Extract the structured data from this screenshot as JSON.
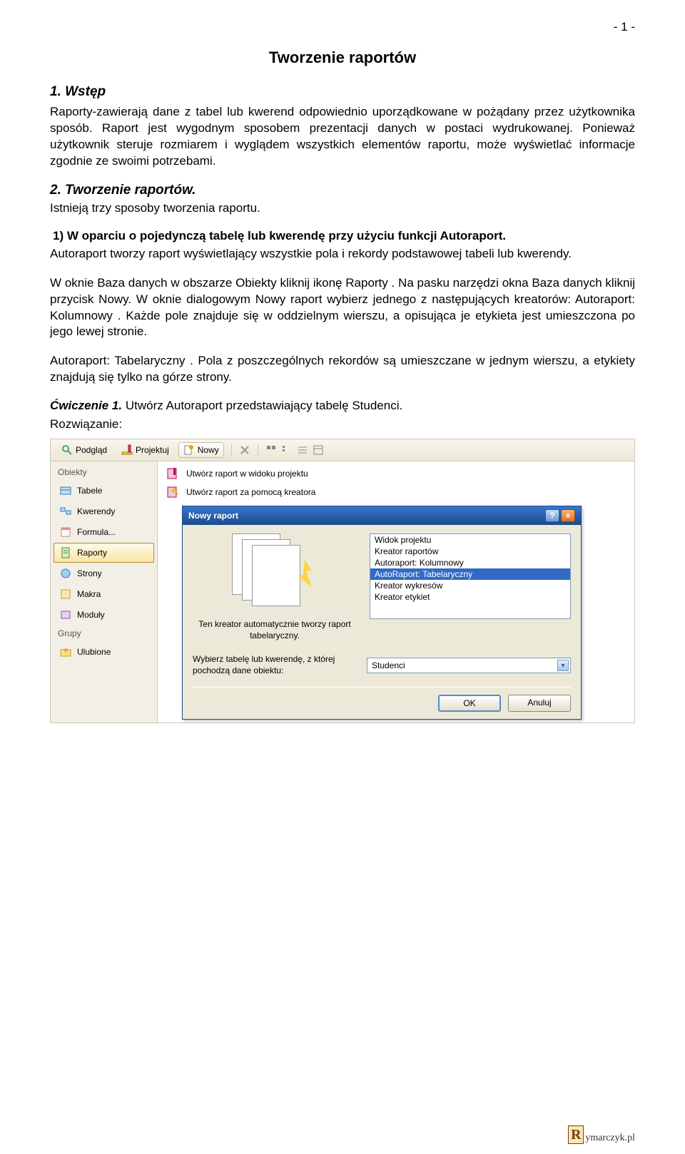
{
  "page_number": "- 1 -",
  "title": "Tworzenie raportów",
  "section1_heading": "1. Wstęp",
  "section1_text": "Raporty-zawierają dane z tabel lub kwerend odpowiednio uporządkowane w pożądany przez użytkownika sposób. Raport jest wygodnym sposobem prezentacji danych w postaci wydrukowanej. Ponieważ użytkownik steruje rozmiarem i wyglądem wszystkich elementów raportu, może wyświetlać informacje zgodnie ze swoimi potrzebami.",
  "section2_heading": "2. Tworzenie raportów.",
  "section2_sub": "Istnieją trzy sposoby tworzenia raportu.",
  "method1_heading": "1) W oparciu o pojedynczą tabelę lub kwerendę przy użyciu funkcji Autoraport.",
  "method1_p1": "Autoraport tworzy raport wyświetlający wszystkie pola i rekordy podstawowej tabeli lub kwerendy.",
  "method1_p2": "W oknie Baza danych w obszarze Obiekty kliknij ikonę Raporty . Na pasku narzędzi okna Baza danych kliknij przycisk Nowy. W oknie dialogowym Nowy raport wybierz jednego z następujących kreatorów: Autoraport: Kolumnowy . Każde pole znajduje się w oddzielnym wierszu, a opisująca je etykieta jest umieszczona po jego lewej stronie.",
  "method1_p3": "Autoraport: Tabelaryczny . Pola z poszczególnych rekordów są umieszczane w jednym wierszu, a etykiety znajdują się tylko na górze strony.",
  "exercise_label": "Ćwiczenie 1.",
  "exercise_text": "Utwórz Autoraport przedstawiający tabelę Studenci.",
  "solution_label": "Rozwiązanie:",
  "app": {
    "toolbar": {
      "preview": "Podgląd",
      "design": "Projektuj",
      "new": "Nowy"
    },
    "sidebar": {
      "objects": "Obiekty",
      "items": [
        "Tabele",
        "Kwerendy",
        "Formula...",
        "Raporty",
        "Strony",
        "Makra",
        "Moduły"
      ],
      "groups": "Grupy",
      "favorites": "Ulubione"
    },
    "content": {
      "row1": "Utwórz raport w widoku projektu",
      "row2": "Utwórz raport za pomocą kreatora"
    },
    "dialog": {
      "title": "Nowy raport",
      "desc": "Ten kreator automatycznie tworzy raport tabelaryczny.",
      "options": [
        "Widok projektu",
        "Kreator raportów",
        "Autoraport: Kolumnowy",
        "AutoRaport: Tabelaryczny",
        "Kreator wykresów",
        "Kreator etykiet"
      ],
      "selected_index": 3,
      "source_label": "Wybierz tabelę lub kwerendę, z której pochodzą dane obiektu:",
      "source_value": "Studenci",
      "ok": "OK",
      "cancel": "Anuluj"
    }
  },
  "footer": "ymarczyk.pl"
}
